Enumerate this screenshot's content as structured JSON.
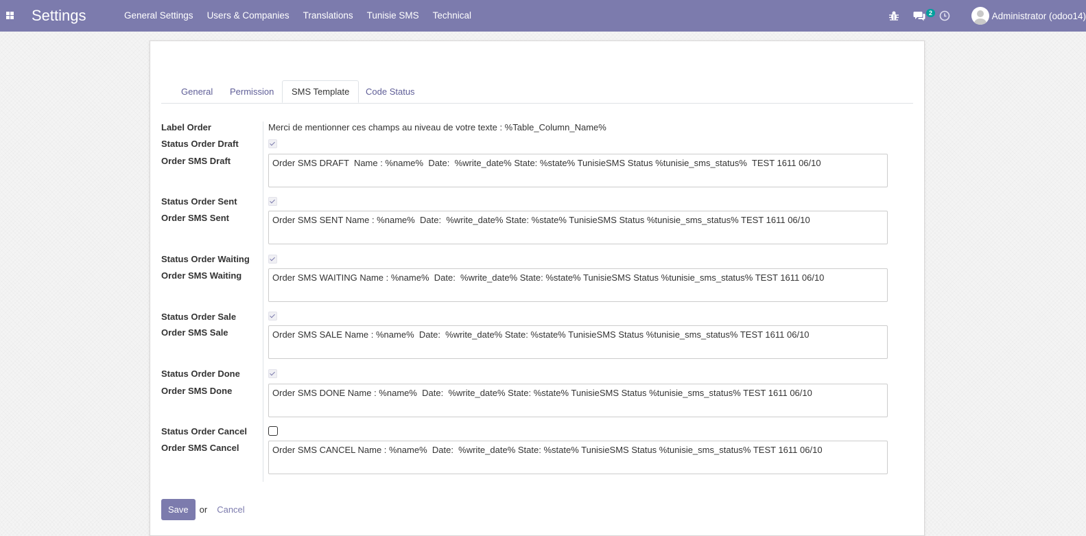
{
  "navbar": {
    "app_title": "Settings",
    "menu": [
      "General Settings",
      "Users & Companies",
      "Translations",
      "Tunisie SMS",
      "Technical"
    ],
    "chat_count": "2",
    "user": "Administrator (odoo14)"
  },
  "tabs": [
    {
      "label": "General",
      "active": false
    },
    {
      "label": "Permission",
      "active": false
    },
    {
      "label": "SMS Template",
      "active": true
    },
    {
      "label": "Code Status",
      "active": false
    }
  ],
  "form": {
    "label_order": "Label Order",
    "hint": "Merci de mentionner ces champs au niveau de votre texte : %Table_Column_Name%",
    "rows": [
      {
        "status_label": "Status Order Draft",
        "checked": true,
        "sms_label": "Order SMS Draft",
        "sms_value": "Order SMS DRAFT  Name : %name%  Date:  %write_date% State: %state% TunisieSMS Status %tunisie_sms_status%  TEST 1611 06/10"
      },
      {
        "status_label": "Status Order Sent",
        "checked": true,
        "sms_label": "Order SMS Sent",
        "sms_value": "Order SMS SENT Name : %name%  Date:  %write_date% State: %state% TunisieSMS Status %tunisie_sms_status% TEST 1611 06/10"
      },
      {
        "status_label": "Status Order Waiting",
        "checked": true,
        "sms_label": "Order SMS Waiting",
        "sms_value": "Order SMS WAITING Name : %name%  Date:  %write_date% State: %state% TunisieSMS Status %tunisie_sms_status% TEST 1611 06/10"
      },
      {
        "status_label": "Status Order Sale",
        "checked": true,
        "sms_label": "Order SMS Sale",
        "sms_value": "Order SMS SALE Name : %name%  Date:  %write_date% State: %state% TunisieSMS Status %tunisie_sms_status% TEST 1611 06/10"
      },
      {
        "status_label": "Status Order Done",
        "checked": true,
        "sms_label": "Order SMS Done",
        "sms_value": "Order SMS DONE Name : %name%  Date:  %write_date% State: %state% TunisieSMS Status %tunisie_sms_status% TEST 1611 06/10"
      },
      {
        "status_label": "Status Order Cancel",
        "checked": false,
        "sms_label": "Order SMS Cancel",
        "sms_value": "Order SMS CANCEL Name : %name%  Date:  %write_date% State: %state% TunisieSMS Status %tunisie_sms_status% TEST 1611 06/10"
      }
    ]
  },
  "actions": {
    "save": "Save",
    "or": "or",
    "cancel": "Cancel"
  },
  "colors": {
    "brand": "#7c7bad",
    "badge": "#00a09d"
  },
  "icons": [
    "apps-icon",
    "bug-icon",
    "chat-icon",
    "clock-icon",
    "avatar"
  ]
}
